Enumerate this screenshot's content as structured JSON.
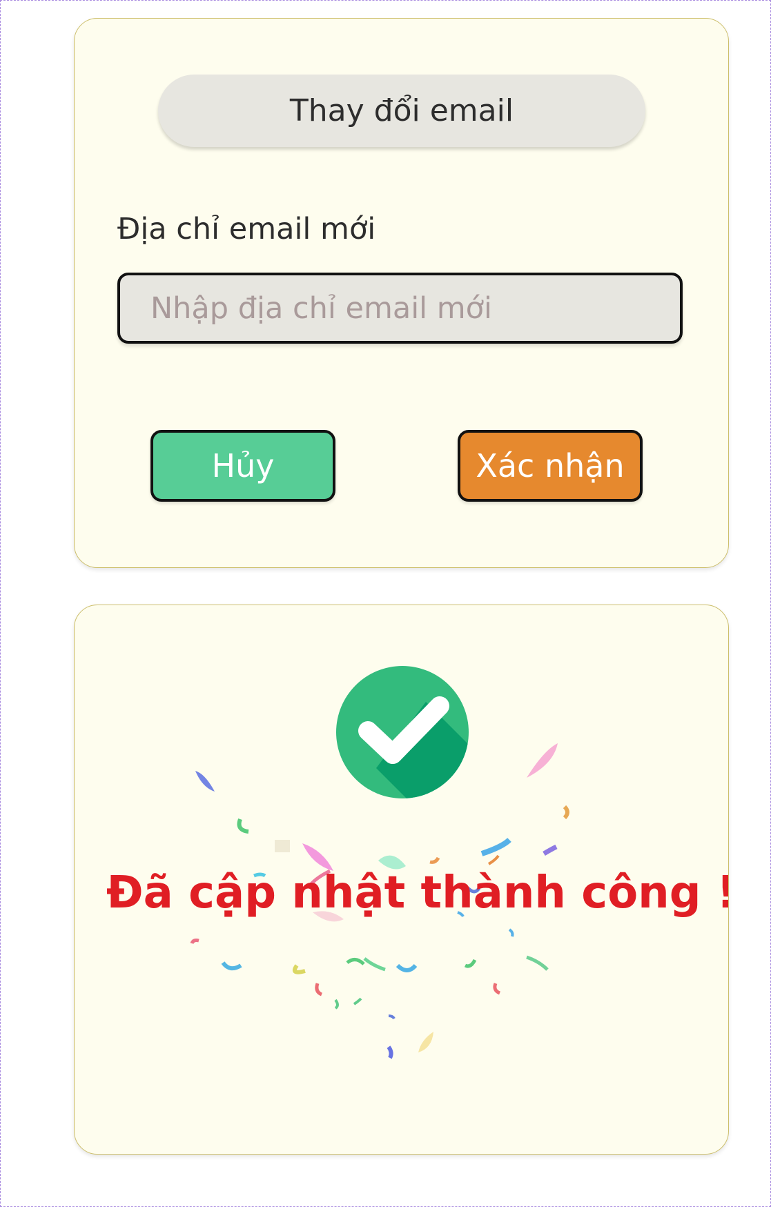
{
  "change_email_card": {
    "title": "Thay đổi email",
    "field_label": "Địa chỉ email mới",
    "input_value": "",
    "input_placeholder": "Nhập địa chỉ email mới",
    "cancel_label": "Hủy",
    "confirm_label": "Xác nhận"
  },
  "success_card": {
    "message": "Đã cập nhật thành công !",
    "icon": "check-circle-icon"
  },
  "colors": {
    "card_background": "#fefdee",
    "cancel_button": "#57cd96",
    "confirm_button": "#e6892e",
    "success_text": "#e01e24",
    "check_circle": "#33bb7d"
  }
}
